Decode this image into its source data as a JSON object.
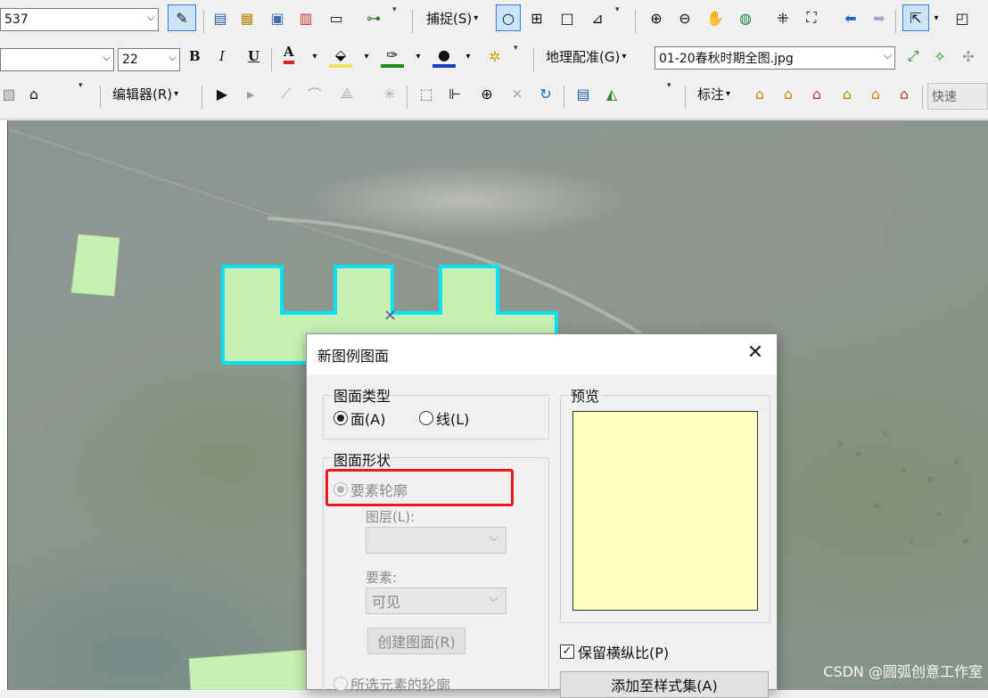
{
  "toolbar": {
    "scale_value": "537",
    "font_name": "",
    "font_size": "22",
    "bold": "B",
    "italic": "I",
    "underline": "U",
    "font_color": "A",
    "snapping_label": "捕捉(S)",
    "georef_label": "地理配准(G)",
    "georef_layer": "01-20春秋时期全图.jpg",
    "editor_label": "编辑器(R)",
    "label_menu": "标注",
    "quick_label": "快速"
  },
  "dialog": {
    "title": "新图例图面",
    "close": "✕",
    "patch_type": {
      "title": "图面类型",
      "area": "面(A)",
      "line": "线(L)"
    },
    "patch_shape": {
      "title": "图面形状",
      "feature_outline": "要素轮廓",
      "layer_label": "图层(L):",
      "layer_value": "",
      "feature_label": "要素:",
      "feature_value": "可见",
      "create_button": "创建图面(R)",
      "selected_outline": "所选元素的轮廓"
    },
    "preview": {
      "title": "预览"
    },
    "keep_aspect": "保留横纵比(P)",
    "add_to_style": "添加至样式集(A)"
  },
  "watermark": "CSDN @圆弧创意工作室",
  "colors": {
    "selection_cyan": "#00e5f5",
    "polygon_fill": "#c8f0b4",
    "preview_fill": "#ffffc0",
    "highlight_red": "#e8191b"
  }
}
